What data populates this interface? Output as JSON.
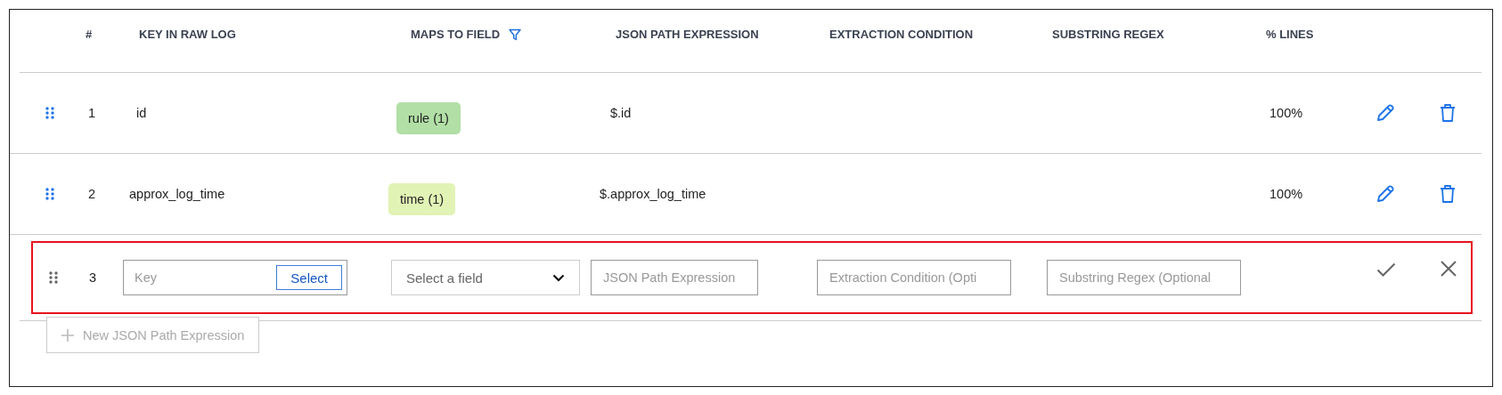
{
  "columns": [
    {
      "label": "#",
      "filterable": false
    },
    {
      "label": "KEY IN RAW LOG",
      "filterable": false
    },
    {
      "label": "MAPS TO FIELD",
      "filterable": true
    },
    {
      "label": "JSON PATH EXPRESSION",
      "filterable": false
    },
    {
      "label": "EXTRACTION CONDITION",
      "filterable": false
    },
    {
      "label": "SUBSTRING REGEX",
      "filterable": false
    },
    {
      "label": "% LINES",
      "filterable": false
    }
  ],
  "rows": [
    {
      "kind": "saved",
      "highlighted": false,
      "number": "1",
      "key": "id",
      "field": {
        "label": "rule (1)",
        "color": "#b1dfa5"
      },
      "json_path": "$.id",
      "lines": "100%"
    },
    {
      "kind": "saved",
      "highlighted": false,
      "number": "2",
      "key": "approx_log_time",
      "field": {
        "label": "time (1)",
        "color": "#e1f3b5"
      },
      "json_path": "$.approx_log_time",
      "lines": "100%"
    },
    {
      "kind": "edit",
      "highlighted": true,
      "number": "3",
      "key_input": {
        "placeholder": "Key"
      },
      "select_button": "Select",
      "field_select": {
        "placeholder": "Select a field"
      },
      "json_path_input": {
        "placeholder": "JSON Path Expression"
      },
      "condition_input": {
        "placeholder": "Extraction Condition (Opti"
      },
      "regex_input": {
        "placeholder": "Substring Regex (Optional"
      }
    }
  ],
  "add_button": {
    "label": "New JSON Path Expression",
    "disabled": true
  }
}
